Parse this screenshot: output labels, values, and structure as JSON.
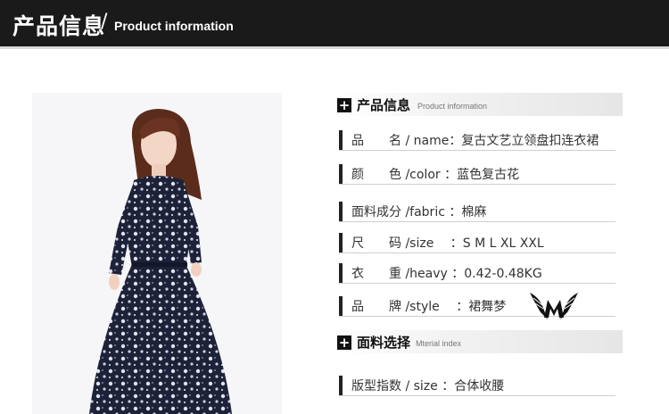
{
  "banner": {
    "title_cn": "产品信息",
    "slash": "/",
    "title_en": "Product information"
  },
  "product_info": {
    "header_cn": "产品信息",
    "header_en": "Product information",
    "rows": [
      {
        "label": "品　　名 / name：复古文艺立领盘扣连衣裙"
      },
      {
        "label": "颜　　色 /color ：蓝色复古花"
      },
      {
        "label": "面料成分 /fabric ：棉麻"
      },
      {
        "label": "尺　　码 /size　 ：S  M L XL XXL"
      },
      {
        "label": "衣　　重 /heavy ：0.42-0.48KG"
      },
      {
        "label": "品　　牌 /style　 ：裙舞梦"
      }
    ]
  },
  "material": {
    "header_cn": "面料选择",
    "header_en": "Mterial index",
    "rows": [
      {
        "label": "版型指数 / size ：合体收腰"
      }
    ]
  },
  "brand_logo": {
    "icon": "winged-m-logo"
  },
  "colors": {
    "banner": "#1a1a1a",
    "accent": "#111111"
  }
}
